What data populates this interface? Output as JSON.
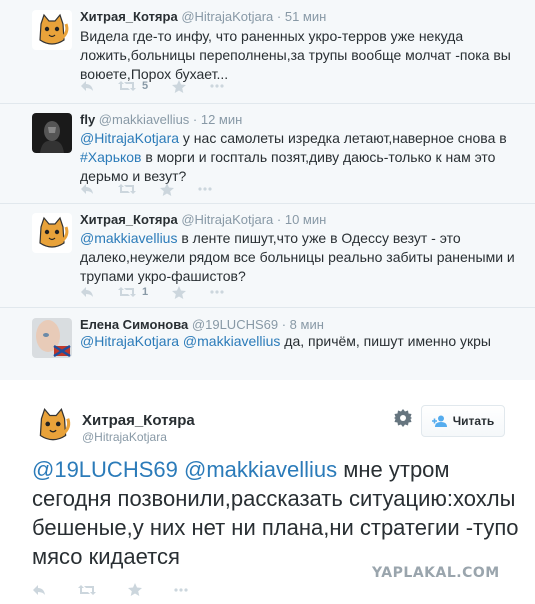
{
  "replies": [
    {
      "name": "Хитрая_Котяра",
      "handle": "@HitrajaKotjara",
      "time": "· 51 мин",
      "text": "Видела где-то инфу, что раненных укро-терров уже некуда ложить,больницы переполнены,за трупы вообще молчат -пока вы воюете,Порох бухает...",
      "retweets": "5",
      "avatar": "cat-avatar"
    },
    {
      "name": "fly",
      "handle": "@makkiavellius",
      "time": "· 12 мин",
      "mention": "@HitrajaKotjara",
      "text_a": " у нас самолеты изредка летают,наверное снова в ",
      "hashtag": "#Харьков",
      "text_b": " в морги и госпталь позят,диву даюсь-только к нам это дерьмо и везут?",
      "avatar": "dark-figure-avatar"
    },
    {
      "name": "Хитрая_Котяра",
      "handle": "@HitrajaKotjara",
      "time": "· 10 мин",
      "mention": "@makkiavellius",
      "text": " в ленте пишут,что уже в Одессу везут - это далеко,неужели рядом все больницы реально забиты ранеными и трупами укро-фашистов?",
      "retweets": "1",
      "avatar": "cat-avatar"
    },
    {
      "name": "Елена Симонова",
      "handle": "@19LUCHS69",
      "time": "· 8 мин",
      "mention_a": "@HitrajaKotjara",
      "mention_b": "@makkiavellius",
      "text": " да, причём, пишут именно укры",
      "avatar": "woman-flag-avatar"
    }
  ],
  "main": {
    "name": "Хитрая_Котяра",
    "handle": "@HitrajaKotjara",
    "follow_label": "Читать",
    "mention_a": "@19LUCHS69",
    "mention_b": "@makkiavellius",
    "text": " мне утром сегодня позвонили,рассказать ситуацию:хохлы бешеные,у них нет ни плана,ни стратегии -тупо мясо кидается"
  },
  "watermark": "YAPLAKAL.COM",
  "colors": {
    "link": "#2b7bb9",
    "name": "#292f33",
    "muted": "#8899a6",
    "thread_bg": "#f5f8fa",
    "icon": "#ccd6dd"
  }
}
